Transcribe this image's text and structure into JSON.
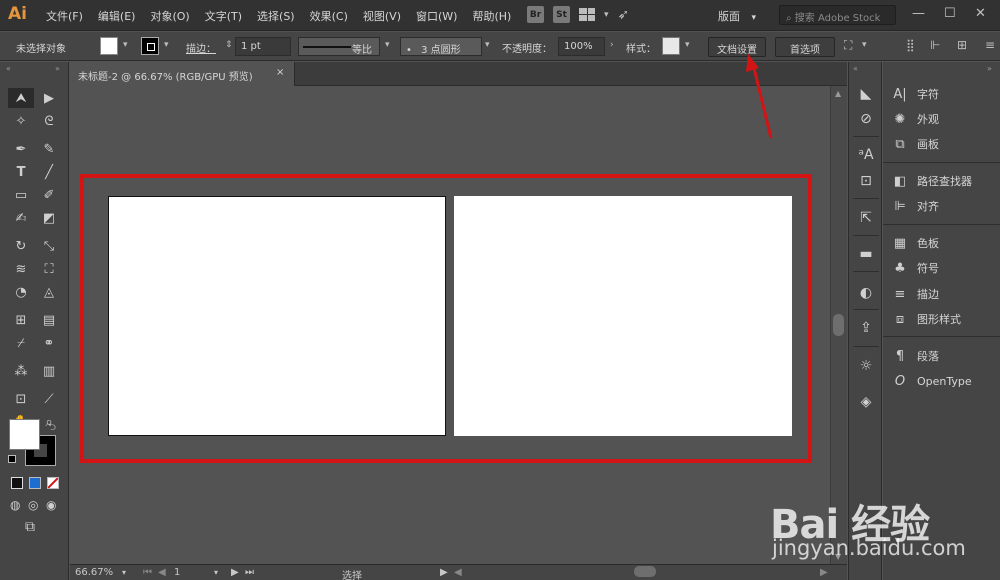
{
  "app": {
    "logo": "Ai"
  },
  "menubar": {
    "items": [
      "文件(F)",
      "编辑(E)",
      "对象(O)",
      "文字(T)",
      "选择(S)",
      "效果(C)",
      "视图(V)",
      "窗口(W)",
      "帮助(H)"
    ],
    "bridge_label": "Br",
    "stock_label": "St",
    "workspace_label": "版面",
    "search_placeholder": "搜索 Adobe Stock"
  },
  "controlbar": {
    "selection_status": "未选择对象",
    "stroke_label": "描边：",
    "stroke_weight": "1 pt",
    "stroke_profile": "等比",
    "brush_label": "3 点圆形",
    "opacity_label": "不透明度：",
    "opacity_value": "100%",
    "style_label": "样式：",
    "doc_setup_label": "文档设置",
    "preferences_label": "首选项"
  },
  "document": {
    "tab_title": "未标题-2 @ 66.67% (RGB/GPU 预览)",
    "close_glyph": "×",
    "artboard_count": 2
  },
  "statusbar": {
    "zoom": "66.67%",
    "page": "1",
    "mode": "选择"
  },
  "right_panel": {
    "items": [
      {
        "icon": "character-icon",
        "label": "字符"
      },
      {
        "icon": "appearance-icon",
        "label": "外观"
      },
      {
        "icon": "artboards-icon",
        "label": "画板"
      },
      {
        "icon": "pathfinder-icon",
        "label": "路径查找器"
      },
      {
        "icon": "align-icon",
        "label": "对齐"
      },
      {
        "icon": "swatches-icon",
        "label": "色板"
      },
      {
        "icon": "symbols-icon",
        "label": "符号"
      },
      {
        "icon": "stroke-icon",
        "label": "描边"
      },
      {
        "icon": "graphic-styles-icon",
        "label": "图形样式"
      },
      {
        "icon": "paragraph-icon",
        "label": "段落"
      },
      {
        "icon": "opentype-icon",
        "label": "OpenType"
      }
    ]
  },
  "watermark": {
    "brand": "Bai 经验",
    "url": "jingyan.baidu.com"
  },
  "colors": {
    "app_bg": "#535353",
    "panel_bg": "#454545",
    "highlight_red": "#d21414",
    "logo_orange": "#e3963e"
  }
}
